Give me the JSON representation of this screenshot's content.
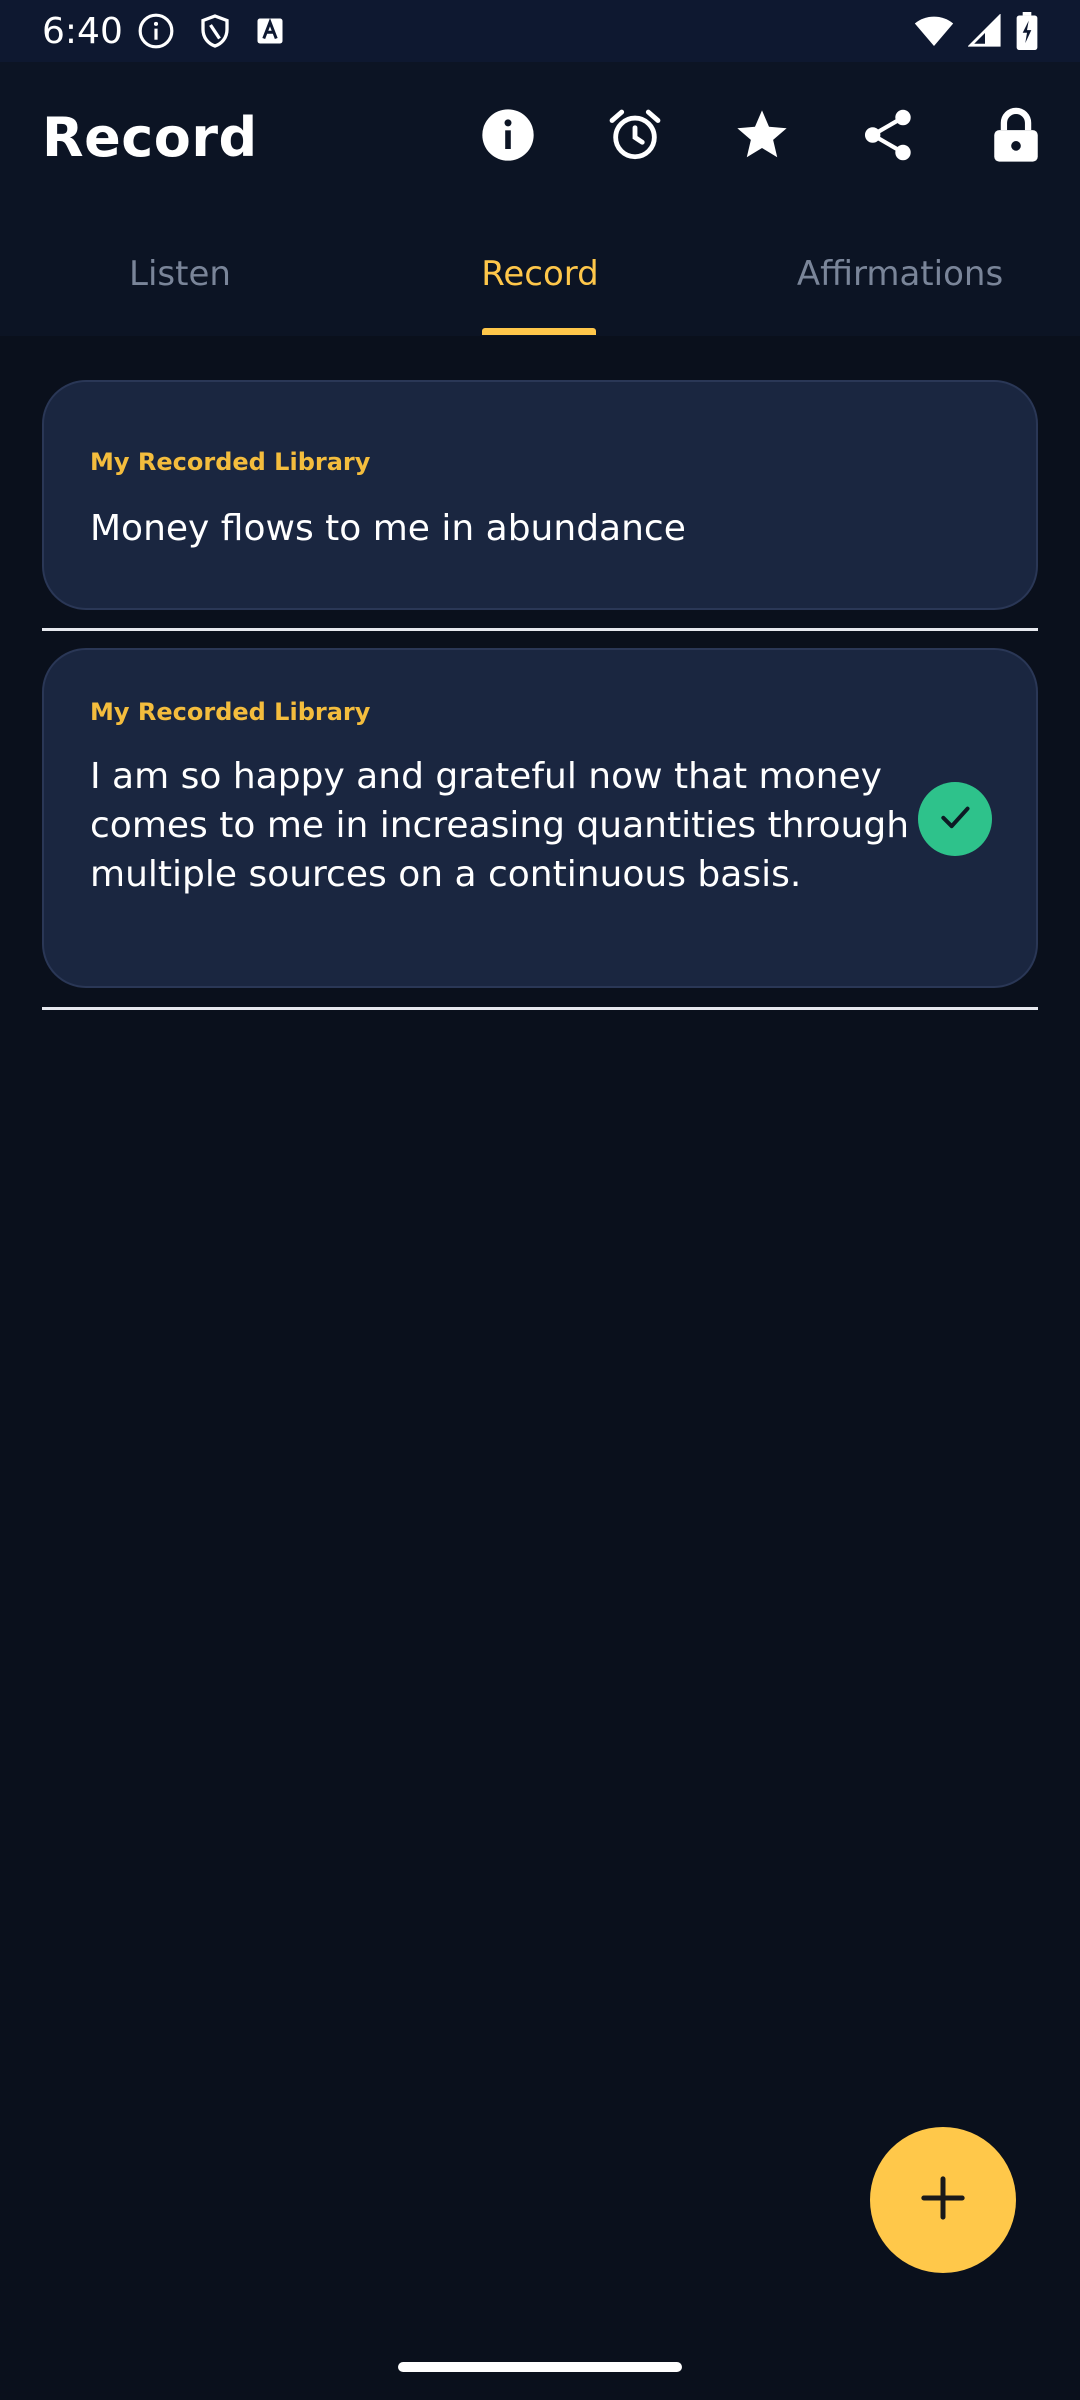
{
  "status_bar": {
    "time": "6:40",
    "icons": [
      "info-icon",
      "shield-icon",
      "a-badge-icon",
      "wifi-icon",
      "cell-signal-icon",
      "battery-charging-icon"
    ]
  },
  "app_bar": {
    "title": "Record",
    "actions": [
      "info-icon",
      "alarm-icon",
      "star-icon",
      "share-icon",
      "lock-icon"
    ]
  },
  "tabs": {
    "items": [
      {
        "label": "Listen",
        "active": false
      },
      {
        "label": "Record",
        "active": true
      },
      {
        "label": "Affirmations",
        "active": false
      }
    ]
  },
  "recordings": [
    {
      "category": "My Recorded Library",
      "text": "Money flows to me in abundance",
      "selected": false
    },
    {
      "category": "My Recorded Library",
      "text": "I am so happy and grateful now that money comes to me in increasing quantities through multiple sources on a continuous basis.",
      "selected": true
    }
  ],
  "fab": {
    "icon": "plus-icon"
  },
  "colors": {
    "background": "#0a101c",
    "accent": "#ffc74a",
    "card": "#1a2640",
    "check": "#2ec28b"
  }
}
